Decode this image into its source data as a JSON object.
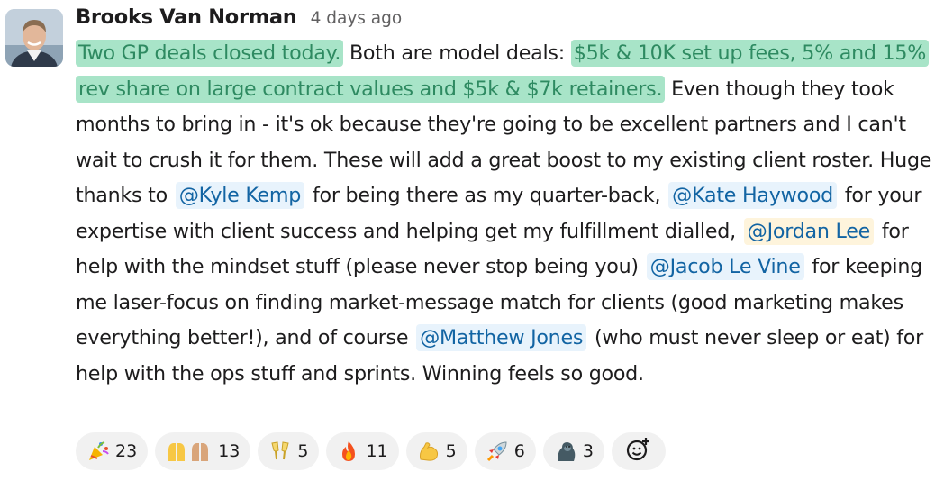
{
  "message": {
    "author": "Brooks Van Norman",
    "timestamp": "4 days ago",
    "seg_hl1": "Two GP deals closed today.",
    "seg_t1": " Both are model deals: ",
    "seg_hl2": "$5k & 10K set up fees, 5% and 15% rev share on large contract values and $5k & $7k retainers.",
    "seg_t2": " Even though they took months to bring in - it's ok because they're going to be excellent partners and I can't wait to crush it for them. These will add a great boost to my existing client roster. Huge thanks to ",
    "mention_kyle": "@Kyle Kemp",
    "seg_t3": " for being there as my quarter-back, ",
    "mention_kate": "@Kate Haywood",
    "seg_t4": " for your expertise with client success and helping get my fulfillment dialled, ",
    "mention_jordan": "@Jordan Lee",
    "seg_t5": " for help with the mindset stuff (please never stop being you) ",
    "mention_jacob": "@Jacob Le Vine",
    "seg_t6": " for keeping me laser-focus on finding market-message match for clients (good marketing makes everything better!), and of course ",
    "mention_matthew": "@Matthew Jones",
    "seg_t7": " (who must never sleep or eat) for help with the ops stuff and sprints. Winning feels so good."
  },
  "reactions": [
    {
      "emoji": "party-popper",
      "count": "23"
    },
    {
      "emoji": "raised-hands",
      "count": "13"
    },
    {
      "emoji": "clinking-glasses",
      "count": "5"
    },
    {
      "emoji": "fire",
      "count": "11"
    },
    {
      "emoji": "flexed-biceps",
      "count": "5"
    },
    {
      "emoji": "rocket",
      "count": "6"
    },
    {
      "emoji": "gorilla",
      "count": "3"
    }
  ],
  "colors": {
    "highlight_bg": "#a8e4c8",
    "highlight_text": "#2e8a61",
    "mention_bg": "#e8f3fc",
    "mention_text": "#1264a3",
    "self_mention_bg": "#fef4dc"
  }
}
